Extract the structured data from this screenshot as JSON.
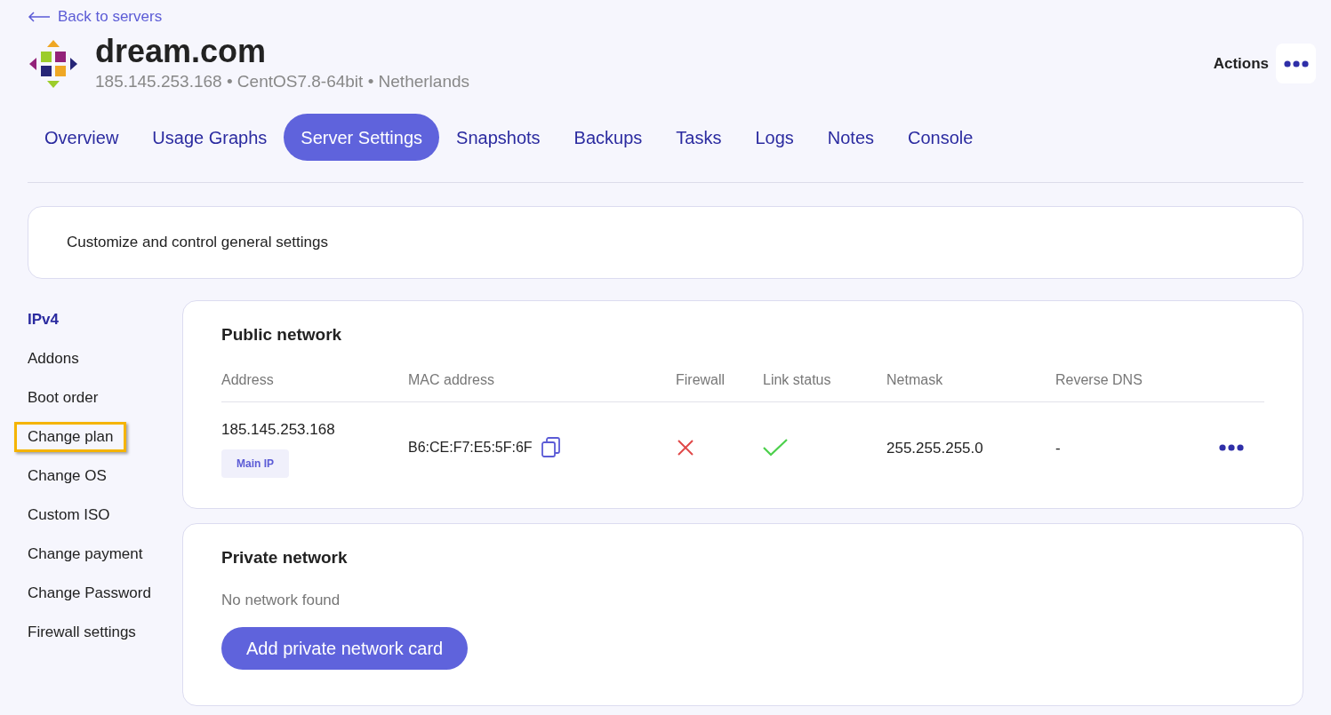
{
  "back_link": "Back to servers",
  "server": {
    "name": "dream.com",
    "details": "185.145.253.168 • CentOS7.8-64bit • Netherlands"
  },
  "actions": {
    "label": "Actions"
  },
  "tabs": [
    {
      "label": "Overview",
      "selected": false
    },
    {
      "label": "Usage Graphs",
      "selected": false
    },
    {
      "label": "Server Settings",
      "selected": true
    },
    {
      "label": "Snapshots",
      "selected": false
    },
    {
      "label": "Backups",
      "selected": false
    },
    {
      "label": "Tasks",
      "selected": false
    },
    {
      "label": "Logs",
      "selected": false
    },
    {
      "label": "Notes",
      "selected": false
    },
    {
      "label": "Console",
      "selected": false
    }
  ],
  "intro": "Customize and control general settings",
  "sidebar": {
    "items": [
      {
        "label": "IPv4",
        "selected": true,
        "highlighted": false
      },
      {
        "label": "Addons",
        "selected": false,
        "highlighted": false
      },
      {
        "label": "Boot order",
        "selected": false,
        "highlighted": false
      },
      {
        "label": "Change plan",
        "selected": false,
        "highlighted": true
      },
      {
        "label": "Change OS",
        "selected": false,
        "highlighted": false
      },
      {
        "label": "Custom ISO",
        "selected": false,
        "highlighted": false
      },
      {
        "label": "Change payment",
        "selected": false,
        "highlighted": false
      },
      {
        "label": "Change Password",
        "selected": false,
        "highlighted": false
      },
      {
        "label": "Firewall settings",
        "selected": false,
        "highlighted": false
      }
    ]
  },
  "public_network": {
    "title": "Public network",
    "columns": [
      "Address",
      "MAC address",
      "Firewall",
      "Link status",
      "Netmask",
      "Reverse DNS"
    ],
    "rows": [
      {
        "address": "185.145.253.168",
        "badge": "Main IP",
        "mac": "B6:CE:F7:E5:5F:6F",
        "firewall": false,
        "link_up": true,
        "netmask": "255.255.255.0",
        "reverse_dns": "-"
      }
    ]
  },
  "private_network": {
    "title": "Private network",
    "empty_text": "No network found",
    "button": "Add private network card"
  }
}
